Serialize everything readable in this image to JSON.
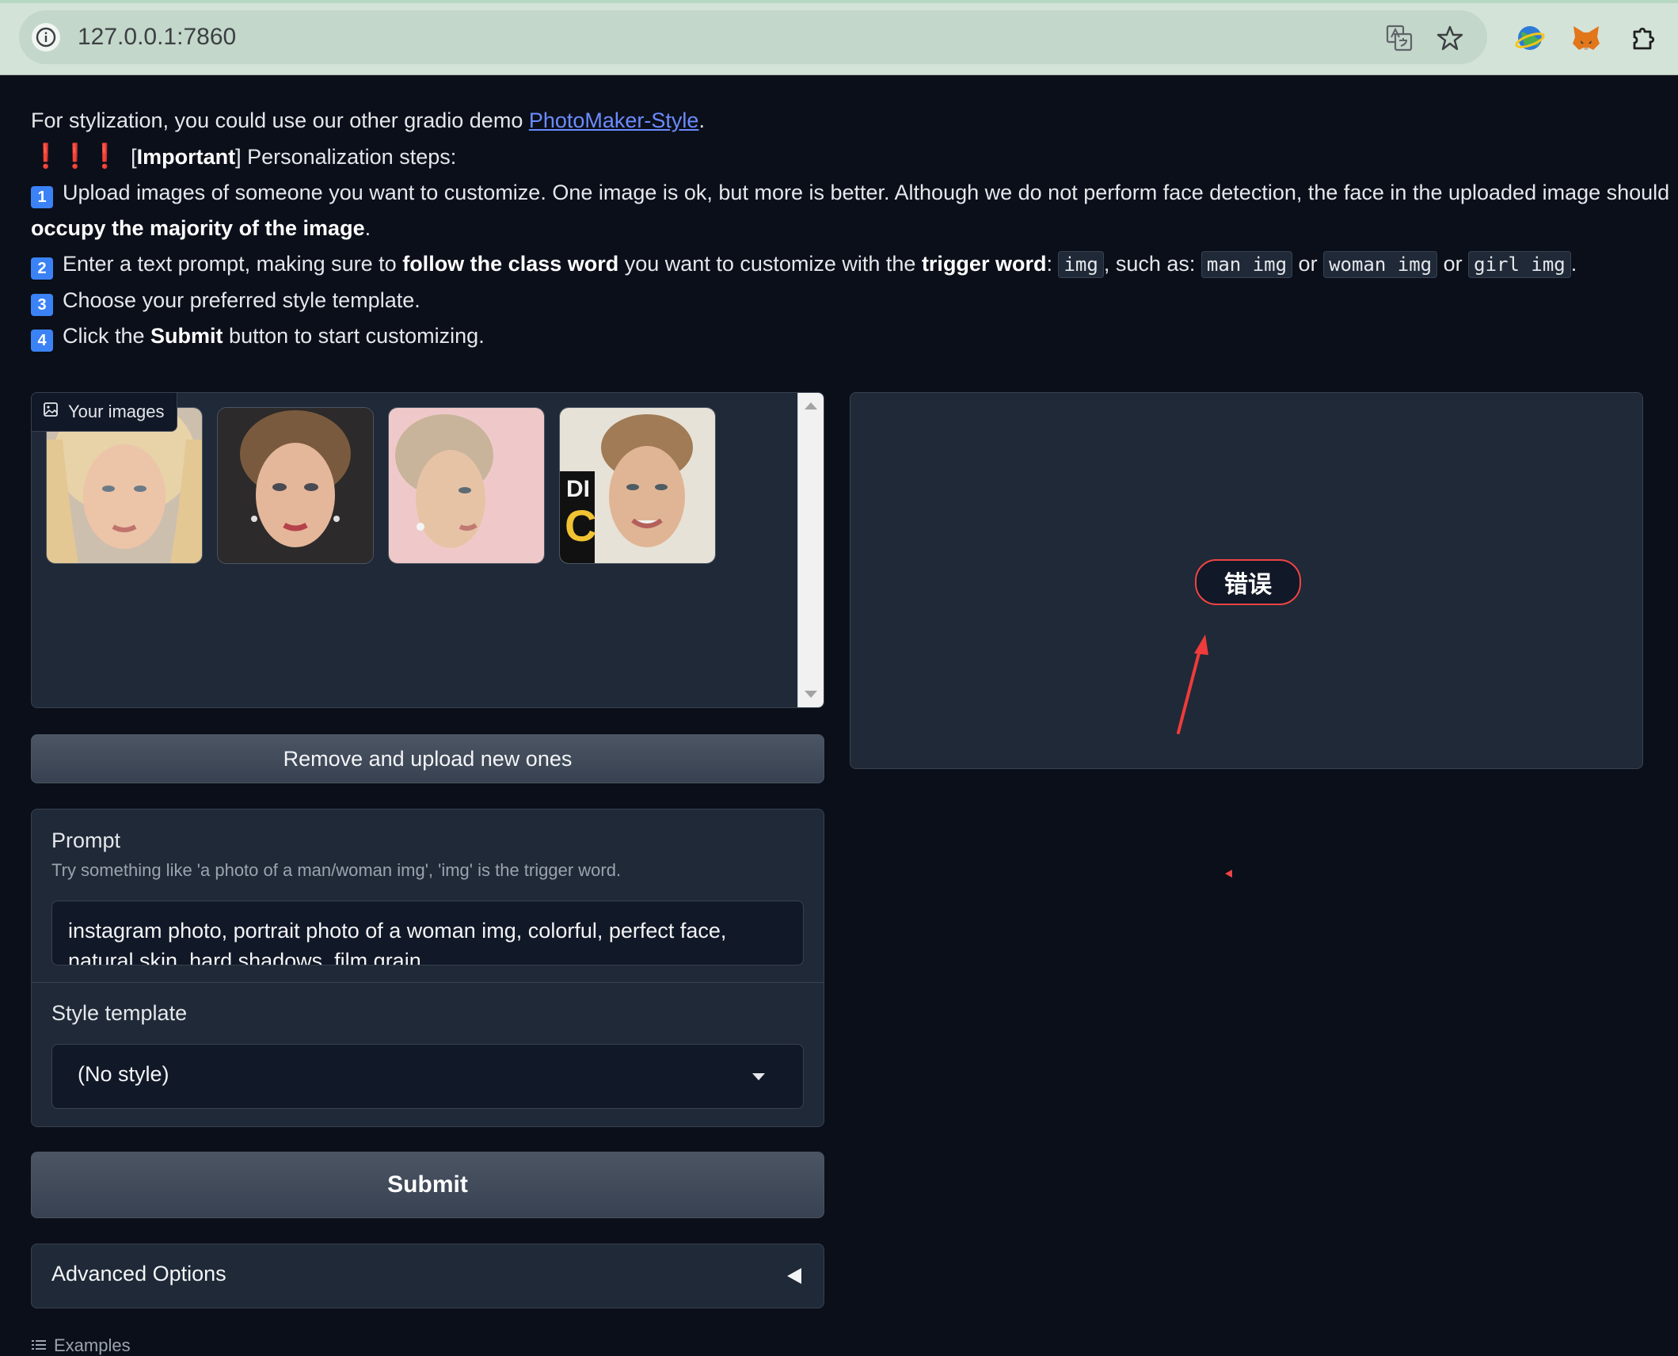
{
  "browser": {
    "url": "127.0.0.1:7860"
  },
  "description": {
    "line1_prefix": "For stylization, you could use our other gradio demo ",
    "line1_link": "PhotoMaker-Style",
    "line1_suffix": ".",
    "important_marks": "❗❗❗",
    "important_open": "[",
    "important_bold": "Important",
    "important_rest": "] Personalization steps:",
    "step1_num": "1",
    "step1_text": "Upload images of someone you want to customize. One image is ok, but more is better. Although we do not perform face detection, the face in the uploaded image should",
    "step1_bold_cont": "occupy the majority of the image",
    "step1_end": ".",
    "step2_num": "2",
    "step2_a": "Enter a text prompt, making sure to ",
    "step2_bold1": "follow the class word",
    "step2_b": " you want to customize with the ",
    "step2_bold2": "trigger word",
    "step2_c": ": ",
    "step2_code1": "img",
    "step2_d": ", such as: ",
    "step2_code2": "man img",
    "step2_or1": " or ",
    "step2_code3": "woman img",
    "step2_or2": " or ",
    "step2_code4": "girl img",
    "step2_end": ".",
    "step3_num": "3",
    "step3_text": "Choose your preferred style template.",
    "step4_num": "4",
    "step4_a": "Click the ",
    "step4_bold": "Submit",
    "step4_b": " button to start customizing."
  },
  "gallery": {
    "label": "Your images",
    "image_count": 4
  },
  "remove_button": "Remove and upload new ones",
  "prompt": {
    "label": "Prompt",
    "info": "Try something like 'a photo of a man/woman img', 'img' is the trigger word.",
    "value": "instagram photo, portrait photo of a woman img, colorful, perfect face, natural skin, hard shadows, film grain"
  },
  "style_template": {
    "label": "Style template",
    "selected": "(No style)"
  },
  "submit_button": "Submit",
  "advanced_options": "Advanced Options",
  "examples_label": "Examples",
  "output": {
    "error_badge": "错误"
  },
  "colors": {
    "background": "#0b0f19",
    "panel": "#1f2937",
    "link": "#6b8cff",
    "error": "#ef4444",
    "badge_blue": "#3b82f6"
  }
}
